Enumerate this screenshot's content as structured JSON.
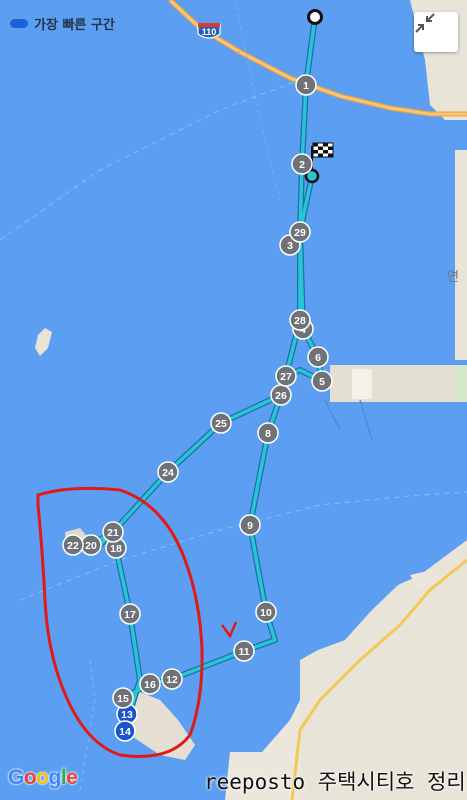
{
  "legend": {
    "label": "가장 빠른 구간",
    "color": "#1a63d8"
  },
  "collapse_button": {
    "icon": "collapse-arrows-icon"
  },
  "highway": {
    "number": "110"
  },
  "place_labels": {
    "east_edge": "연"
  },
  "route": {
    "color": "#29c5d6",
    "waypoints": [
      "1",
      "2",
      "3",
      "4",
      "5",
      "6",
      "8",
      "9",
      "10",
      "11",
      "12",
      "13",
      "14",
      "15",
      "16",
      "17",
      "18",
      "20",
      "21",
      "22",
      "24",
      "25",
      "26",
      "27",
      "28",
      "29"
    ]
  },
  "markers": {
    "start": "start-point",
    "finish": "finish-flag"
  },
  "annotation": {
    "text": "v",
    "color": "#e0201a"
  },
  "attribution": {
    "logo": "Google"
  },
  "watermark": {
    "text": "reeposto 주택시티호 정리"
  }
}
